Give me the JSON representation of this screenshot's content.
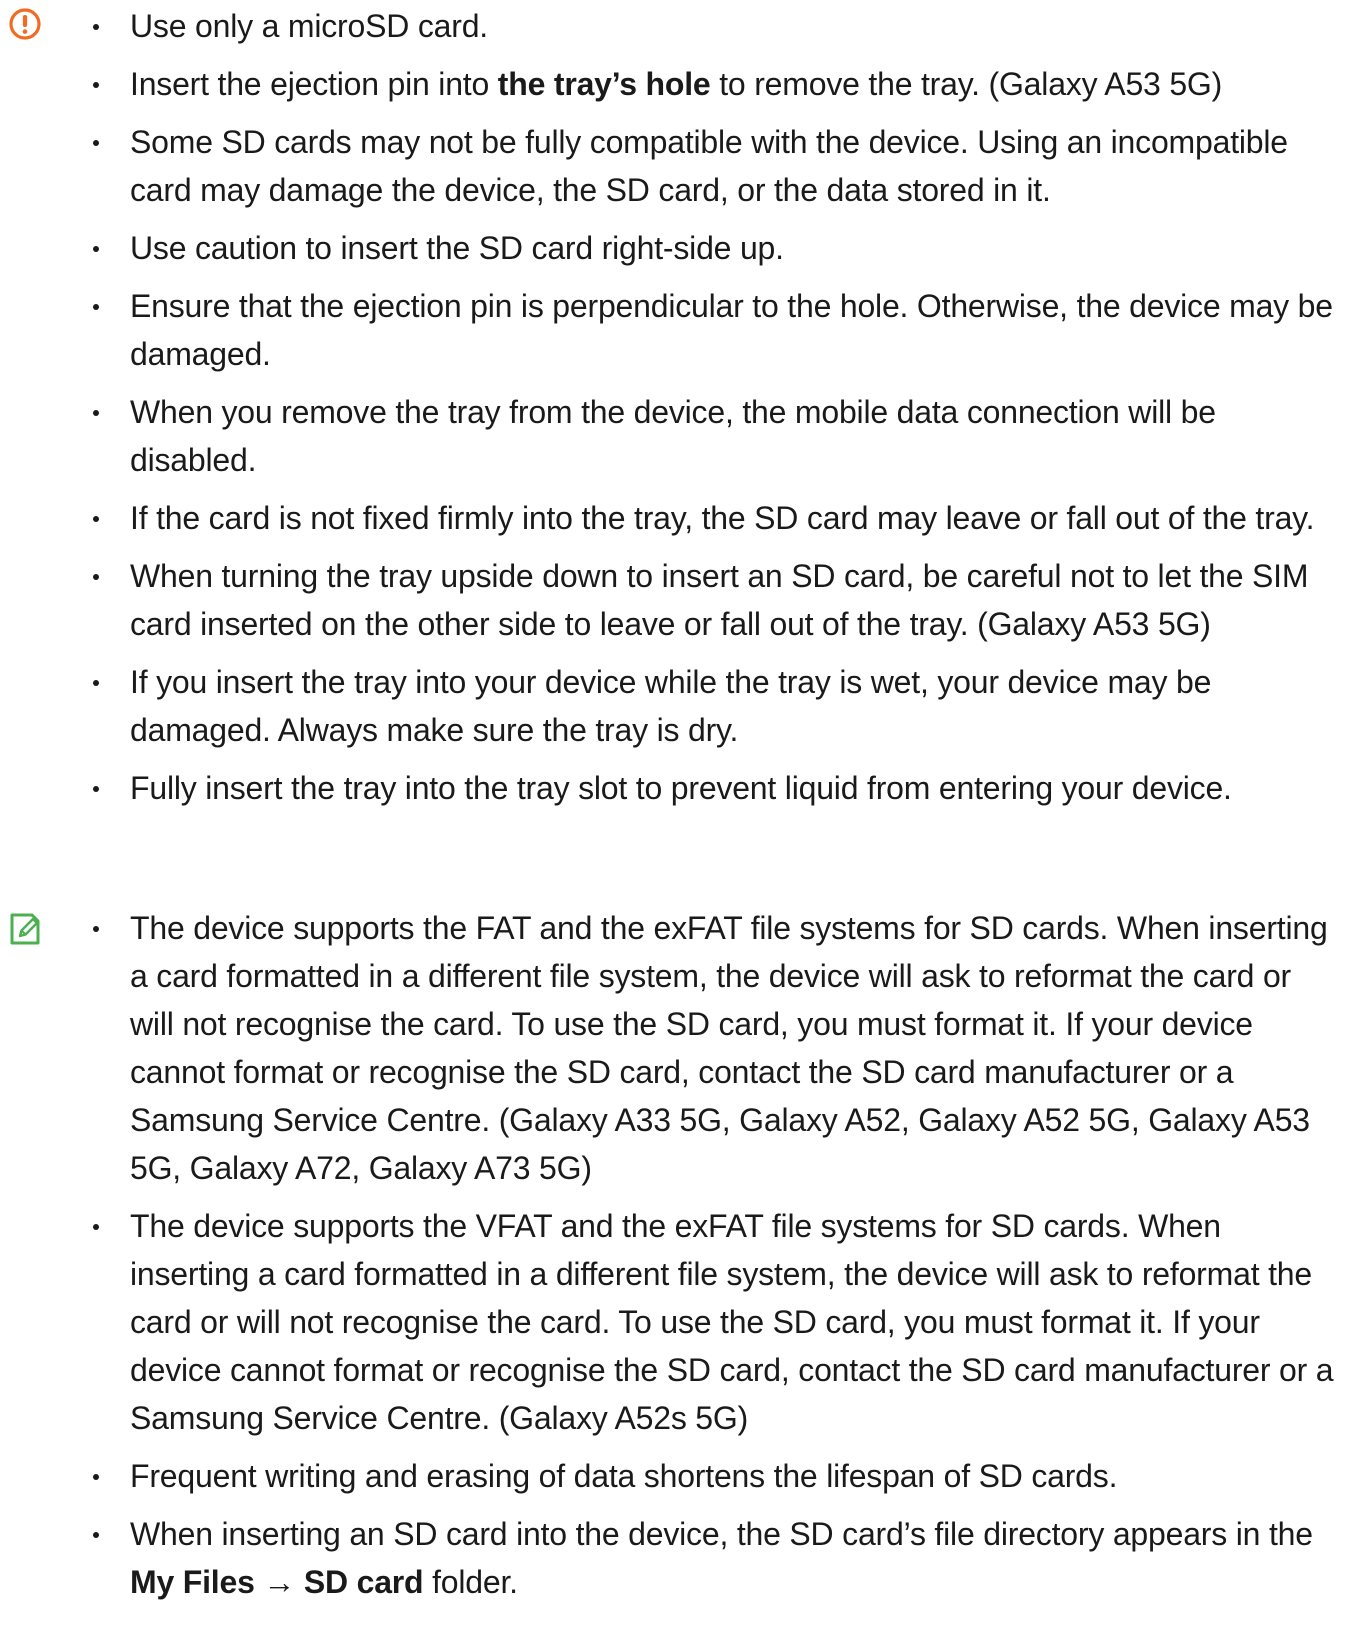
{
  "caution": {
    "icon": "caution-icon",
    "icon_color": "#f26b21",
    "items": [
      [
        {
          "t": "Use only a microSD card."
        }
      ],
      [
        {
          "t": "Insert the ejection pin into "
        },
        {
          "t": "the tray’s hole",
          "b": true
        },
        {
          "t": " to remove the tray. (Galaxy A53 5G)"
        }
      ],
      [
        {
          "t": "Some SD cards may not be fully compatible with the device. Using an incompatible card may damage the device, the SD card, or the data stored in it."
        }
      ],
      [
        {
          "t": "Use caution to insert the SD card right-side up."
        }
      ],
      [
        {
          "t": "Ensure that the ejection pin is perpendicular to the hole. Otherwise, the device may be damaged."
        }
      ],
      [
        {
          "t": "When you remove the tray from the device, the mobile data connection will be disabled."
        }
      ],
      [
        {
          "t": "If the card is not fixed firmly into the tray, the SD card may leave or fall out of the tray."
        }
      ],
      [
        {
          "t": "When turning the tray upside down to insert an SD card, be careful not to let the SIM card inserted on the other side to leave or fall out of the tray. (Galaxy A53 5G)"
        }
      ],
      [
        {
          "t": "If you insert the tray into your device while the tray is wet, your device may be damaged. Always make sure the tray is dry."
        }
      ],
      [
        {
          "t": "Fully insert the tray into the tray slot to prevent liquid from entering your device."
        }
      ]
    ]
  },
  "note": {
    "icon": "note-pencil-icon",
    "icon_color": "#4caf50",
    "items": [
      [
        {
          "t": "The device supports the FAT and the exFAT file systems for SD cards. When inserting a card formatted in a different file system, the device will ask to reformat the card or will not recognise the card. To use the SD card, you must format it. If your device cannot format or recognise the SD card, contact the SD card manufacturer or a Samsung Service Centre. (Galaxy A33 5G, Galaxy A52, Galaxy A52 5G, Galaxy A53 5G, Galaxy A72, Galaxy A73 5G)"
        }
      ],
      [
        {
          "t": "The device supports the VFAT and the exFAT file systems for SD cards. When inserting a card formatted in a different file system, the device will ask to reformat the card or will not recognise the card. To use the SD card, you must format it. If your device cannot format or recognise the SD card, contact the SD card manufacturer or a Samsung Service Centre. (Galaxy A52s 5G)"
        }
      ],
      [
        {
          "t": "Frequent writing and erasing of data shortens the lifespan of SD cards."
        }
      ],
      [
        {
          "t": "When inserting an SD card into the device, the SD card’s file directory appears in the "
        },
        {
          "t": "My Files",
          "b": true
        },
        {
          "t": " → "
        },
        {
          "t": "SD card",
          "b": true
        },
        {
          "t": " folder."
        }
      ]
    ]
  }
}
